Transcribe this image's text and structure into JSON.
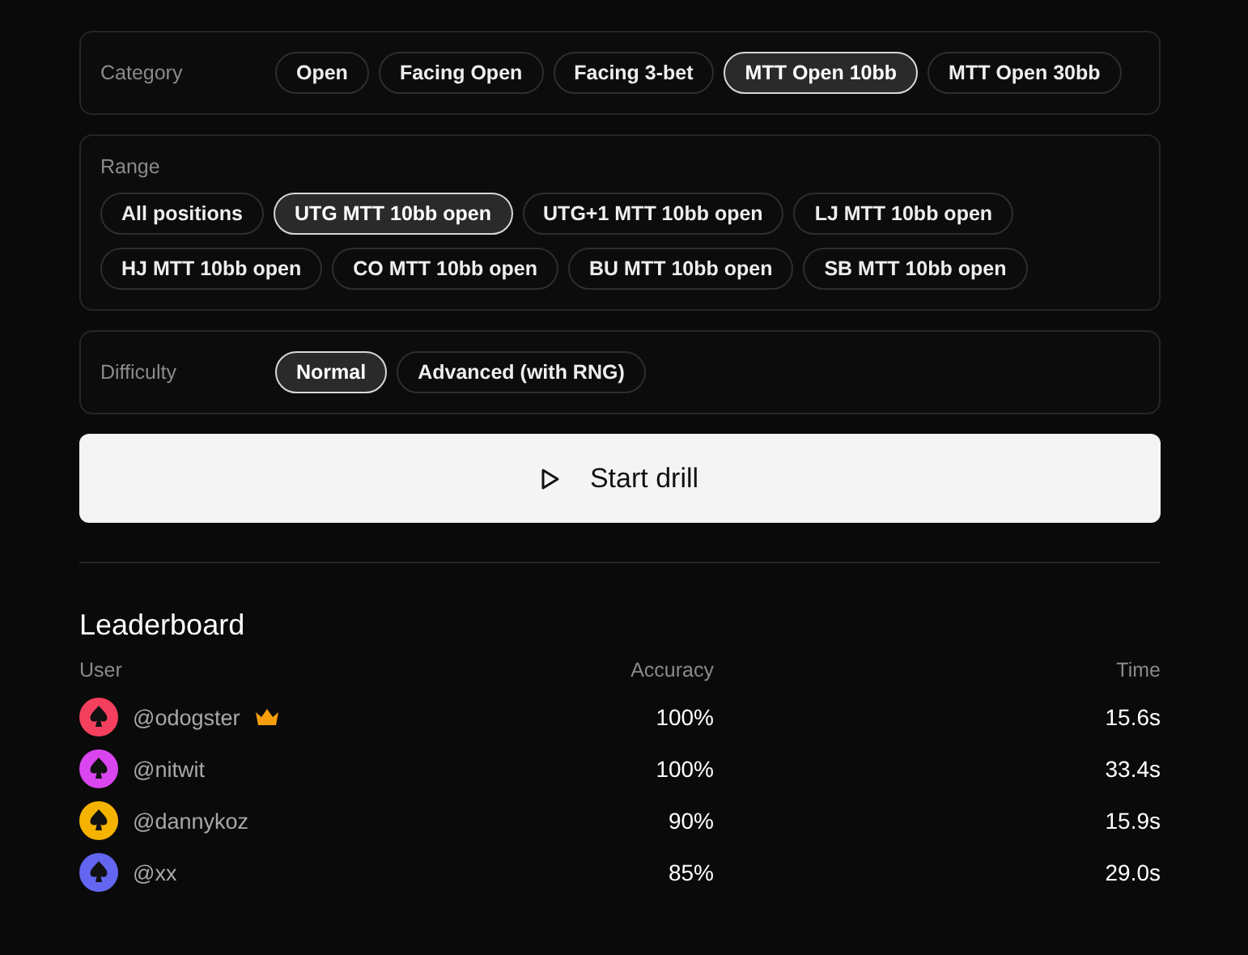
{
  "category": {
    "label": "Category",
    "options": [
      {
        "label": "Open",
        "selected": false
      },
      {
        "label": "Facing Open",
        "selected": false
      },
      {
        "label": "Facing 3-bet",
        "selected": false
      },
      {
        "label": "MTT Open 10bb",
        "selected": true
      },
      {
        "label": "MTT Open 30bb",
        "selected": false
      }
    ]
  },
  "range": {
    "label": "Range",
    "options": [
      {
        "label": "All positions",
        "selected": false
      },
      {
        "label": "UTG MTT 10bb open",
        "selected": true
      },
      {
        "label": "UTG+1 MTT 10bb open",
        "selected": false
      },
      {
        "label": "LJ MTT 10bb open",
        "selected": false
      },
      {
        "label": "HJ MTT 10bb open",
        "selected": false
      },
      {
        "label": "CO MTT 10bb open",
        "selected": false
      },
      {
        "label": "BU MTT 10bb open",
        "selected": false
      },
      {
        "label": "SB MTT 10bb open",
        "selected": false
      }
    ]
  },
  "difficulty": {
    "label": "Difficulty",
    "options": [
      {
        "label": "Normal",
        "selected": true
      },
      {
        "label": "Advanced (with RNG)",
        "selected": false
      }
    ]
  },
  "start_button": {
    "label": "Start drill"
  },
  "leaderboard": {
    "title": "Leaderboard",
    "columns": [
      "User",
      "Accuracy",
      "Time"
    ],
    "rows": [
      {
        "user": "@odogster",
        "color": "#f43f5e",
        "crown": true,
        "accuracy": "100%",
        "time": "15.6s"
      },
      {
        "user": "@nitwit",
        "color": "#d946ef",
        "crown": false,
        "accuracy": "100%",
        "time": "33.4s"
      },
      {
        "user": "@dannykoz",
        "color": "#f5b301",
        "crown": false,
        "accuracy": "90%",
        "time": "15.9s"
      },
      {
        "user": "@xx",
        "color": "#6366f1",
        "crown": false,
        "accuracy": "85%",
        "time": "29.0s"
      }
    ]
  }
}
